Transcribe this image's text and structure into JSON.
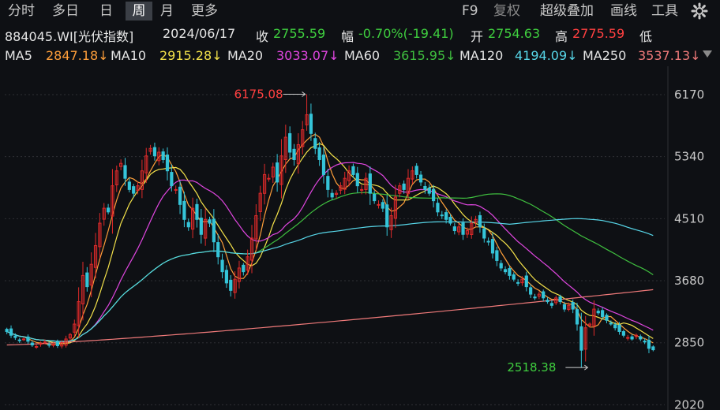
{
  "toolbar": {
    "tabs": [
      "分时",
      "多日",
      "日",
      "周",
      "月",
      "更多"
    ],
    "active_tab": "周",
    "right": [
      "F9",
      "复权",
      "超级叠加",
      "画线",
      "工具"
    ],
    "settings_icon": "gear-icon"
  },
  "info": {
    "code": "884045.WI[光伏指数]",
    "date": "2024/06/17",
    "close_label": "收",
    "close_value": "2755.59",
    "change_label": "幅",
    "change_value": "-0.70%(-19.41)",
    "open_label": "开",
    "open_value": "2754.63",
    "high_label": "高",
    "high_value": "2775.59",
    "low_label": "低"
  },
  "ma_line": [
    {
      "label": "MA5",
      "value": "2847.18↓",
      "color": "#ff9f3a"
    },
    {
      "label": "MA10",
      "value": "2915.28↓",
      "color": "#f4e24a"
    },
    {
      "label": "MA20",
      "value": "3033.07↓",
      "color": "#e046e0"
    },
    {
      "label": "MA60",
      "value": "3615.95↓",
      "color": "#3fbf3f"
    },
    {
      "label": "MA120",
      "value": "4194.09↓",
      "color": "#57d6e8"
    },
    {
      "label": "MA250",
      "value": "3537.13↓",
      "color": "#f07a7a"
    }
  ],
  "colors": {
    "up": "#e02a2a",
    "down": "#35c4d8",
    "grid": "#2f2f35",
    "background": "#0e1014",
    "max_label": "#ff4040",
    "min_label": "#3fcf3f"
  },
  "chart_data": {
    "type": "candlestick",
    "period": "weekly",
    "yticks": [
      6170,
      5340,
      4510,
      3680,
      2850,
      2020
    ],
    "ylim": [
      1950,
      6550
    ],
    "max_annotation": {
      "label": "6175.08",
      "week_index": 71
    },
    "min_annotation": {
      "label": "2518.38",
      "week_index": 136
    },
    "close": [
      3000,
      2950,
      2920,
      2880,
      2900,
      2870,
      2820,
      2800,
      2840,
      2860,
      2820,
      2830,
      2810,
      2850,
      2900,
      2960,
      3100,
      3400,
      3750,
      3600,
      3900,
      4150,
      4450,
      4650,
      4600,
      4950,
      5150,
      5250,
      5050,
      4900,
      4850,
      4950,
      5150,
      5350,
      5450,
      5350,
      5400,
      5300,
      5150,
      4950,
      4900,
      4700,
      4500,
      4400,
      4650,
      4500,
      4300,
      4500,
      4450,
      4200,
      4000,
      3800,
      3650,
      3550,
      3700,
      3850,
      3800,
      4000,
      4250,
      4550,
      4850,
      5100,
      5050,
      5200,
      5000,
      5350,
      5600,
      5400,
      5300,
      5500,
      5700,
      5900,
      5650,
      5450,
      5300,
      5100,
      4900,
      4800,
      4850,
      4950,
      5050,
      5150,
      5100,
      4950,
      4900,
      5050,
      4850,
      4750,
      4700,
      4650,
      4400,
      4550,
      4800,
      4950,
      4900,
      5050,
      5150,
      5100,
      5000,
      4900,
      4850,
      4750,
      4600,
      4550,
      4500,
      4450,
      4350,
      4400,
      4300,
      4350,
      4450,
      4500,
      4400,
      4250,
      4200,
      4050,
      3950,
      3850,
      3800,
      3750,
      3700,
      3650,
      3700,
      3600,
      3500,
      3450,
      3500,
      3450,
      3400,
      3350,
      3450,
      3400,
      3300,
      3350,
      3300,
      3100,
      2750,
      3050,
      3100,
      3300,
      3250,
      3200,
      3150,
      3100,
      3050,
      3000,
      2950,
      2920,
      2900,
      2950,
      2900,
      2860,
      2775,
      2756
    ]
  }
}
